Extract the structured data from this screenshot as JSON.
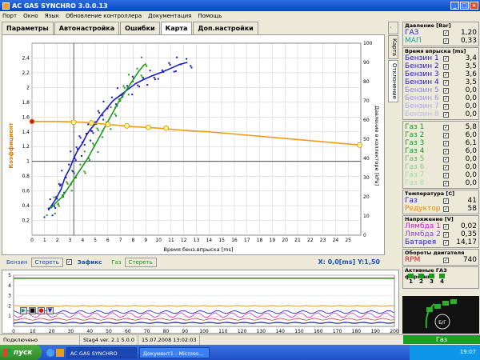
{
  "window": {
    "title": "AC GAS SYNCHRO  3.0.0.13",
    "buttons": [
      "_",
      "□",
      "×"
    ]
  },
  "menu": [
    "Порт",
    "Окно",
    "Язык",
    "Обновление контроллера",
    "Документация",
    "Помощь"
  ],
  "tabs": [
    {
      "label": "Параметры"
    },
    {
      "label": "Автонастройка"
    },
    {
      "label": "Ошибки"
    },
    {
      "label": "Карта"
    },
    {
      "label": "Доп.настройки"
    }
  ],
  "vtabs": [
    "Карта",
    "Отклонение"
  ],
  "chart": {
    "ylabel_left": "Коэффициент",
    "ylabel_right": "Давление в коллекторе [kPa]",
    "xlabel": "Время бенз.впрыска [ms]"
  },
  "chart_data": {
    "type": "scatter",
    "x_ticks": [
      "0",
      "1",
      "2",
      "3",
      "4",
      "5",
      "6",
      "7",
      "8",
      "9",
      "10",
      "11",
      "12",
      "13",
      "14",
      "15",
      "16",
      "17",
      "18",
      "19",
      "20",
      "21",
      "22",
      "23",
      "24",
      "25"
    ],
    "y_left_ticks": [
      "0,2",
      "0,4",
      "0,6",
      "0,8",
      "1",
      "1,2",
      "1,4",
      "1,6",
      "1,8",
      "2",
      "2,2",
      "2,4"
    ],
    "y_right_ticks": [
      "0",
      "10",
      "20",
      "30",
      "40",
      "50",
      "60",
      "70",
      "80",
      "90",
      "100"
    ],
    "xlim": [
      0,
      26
    ],
    "ylim_left": [
      0,
      2.6
    ],
    "ylim_right": [
      0,
      100
    ],
    "series": [
      {
        "color": "#1a1acc",
        "axis": "right",
        "points": [
          [
            1.3,
            13
          ],
          [
            1.6,
            16
          ],
          [
            1.9,
            19
          ],
          [
            2.3,
            24
          ],
          [
            2.6,
            30
          ],
          [
            3,
            35
          ],
          [
            3.3,
            40
          ],
          [
            3.6,
            44
          ],
          [
            4,
            48
          ],
          [
            4.3,
            52
          ],
          [
            4.6,
            55
          ],
          [
            5,
            58
          ],
          [
            5.4,
            62
          ],
          [
            5.9,
            66
          ],
          [
            6.4,
            70
          ],
          [
            7,
            73
          ],
          [
            7.6,
            76
          ],
          [
            8.2,
            79
          ],
          [
            8.8,
            81
          ],
          [
            9.5,
            83
          ],
          [
            10.3,
            85
          ],
          [
            11,
            87
          ],
          [
            11.7,
            89
          ],
          [
            12.3,
            90
          ]
        ]
      },
      {
        "color": "#1a9a1a",
        "axis": "right",
        "points": [
          [
            1.5,
            14
          ],
          [
            1.9,
            17
          ],
          [
            2.4,
            20
          ],
          [
            2.9,
            25
          ],
          [
            3.4,
            30
          ],
          [
            3.9,
            35
          ],
          [
            4.4,
            40
          ],
          [
            4.9,
            46
          ],
          [
            5.4,
            52
          ],
          [
            5.9,
            58
          ],
          [
            6.4,
            64
          ],
          [
            6.9,
            70
          ],
          [
            7.4,
            75
          ],
          [
            7.9,
            80
          ],
          [
            8.4,
            85
          ],
          [
            8.9,
            89
          ]
        ]
      },
      {
        "color": "#f29a1a",
        "axis": "left",
        "points": [
          [
            0,
            1.54
          ],
          [
            2,
            1.54
          ],
          [
            4,
            1.53
          ],
          [
            6,
            1.5
          ],
          [
            8,
            1.47
          ],
          [
            10,
            1.45
          ],
          [
            12,
            1.42
          ],
          [
            14,
            1.4
          ],
          [
            16,
            1.37
          ],
          [
            18,
            1.34
          ],
          [
            20,
            1.31
          ],
          [
            22,
            1.28
          ],
          [
            24,
            1.25
          ],
          [
            26,
            1.22
          ]
        ]
      }
    ],
    "orange_markers": [
      [
        0,
        1.54
      ],
      [
        3.3,
        1.53
      ],
      [
        4.7,
        1.52
      ],
      [
        6,
        1.5
      ],
      [
        7.5,
        1.48
      ],
      [
        9.2,
        1.46
      ],
      [
        10.6,
        1.45
      ],
      [
        25.9,
        1.22
      ]
    ],
    "crosshair": {
      "x": 3.3,
      "y": 1.0
    }
  },
  "bottom": {
    "benzin_label": "Бензин",
    "clear1": "Стереть",
    "zafiks": "Зафикс",
    "gas_label": "Газ",
    "clear2": "Стереть",
    "coord_x": "X: 0,0[ms] Y:1,50"
  },
  "mini_chart": {
    "y_ticks": [
      "1",
      "2",
      "3",
      "4",
      "5"
    ],
    "x_ticks": [
      "0",
      "10",
      "20",
      "30",
      "40",
      "50",
      "60",
      "70",
      "80",
      "90",
      "100",
      "110",
      "120",
      "130",
      "140",
      "150",
      "160",
      "170",
      "180",
      "190",
      "200"
    ]
  },
  "panel": {
    "pressure": {
      "title": "Давление [Bar]",
      "rows": [
        {
          "label": "ГАЗ",
          "value": "1,20",
          "color": "#1a1acc"
        },
        {
          "label": "МАП",
          "value": "0,33",
          "color": "#1aa0a0"
        }
      ]
    },
    "inj_time": {
      "title": "Время впрыска [ms]",
      "rows": [
        {
          "label": "Бензин 1",
          "value": "3,4",
          "color": "#1a1acc"
        },
        {
          "label": "Бензин 2",
          "value": "3,5",
          "color": "#1a1acc"
        },
        {
          "label": "Бензин 3",
          "value": "3,6",
          "color": "#1a1acc"
        },
        {
          "label": "Бензин 4",
          "value": "3,5",
          "color": "#1a1acc"
        },
        {
          "label": "Бензин 5",
          "value": "0,0",
          "color": "#8888dd"
        },
        {
          "label": "Бензин 6",
          "value": "0,0",
          "color": "#9999dd"
        },
        {
          "label": "Бензин 7",
          "value": "0,0",
          "color": "#aaaaee"
        },
        {
          "label": "Бензин 8",
          "value": "0,0",
          "color": "#bbbbee"
        }
      ]
    },
    "gas": {
      "rows": [
        {
          "label": "Газ 1",
          "value": "5,8",
          "color": "#1a9a1a"
        },
        {
          "label": "Газ 2",
          "value": "6,0",
          "color": "#1a9a1a"
        },
        {
          "label": "Газ 3",
          "value": "6,1",
          "color": "#1a9a1a"
        },
        {
          "label": "Газ 4",
          "value": "6,0",
          "color": "#1a9a1a"
        },
        {
          "label": "Газ 5",
          "value": "0,0",
          "color": "#66bb66"
        },
        {
          "label": "Газ 6",
          "value": "0,0",
          "color": "#88cc88"
        },
        {
          "label": "Газ 7",
          "value": "0,0",
          "color": "#99dd99"
        },
        {
          "label": "Газ 8",
          "value": "0,0",
          "color": "#aaddaa"
        }
      ]
    },
    "temperature": {
      "title": "Температура [C]",
      "rows": [
        {
          "label": "Газ",
          "value": "41",
          "color": "#1a1acc"
        },
        {
          "label": "Редуктор",
          "value": "58",
          "color": "#e08a10"
        }
      ]
    },
    "voltage": {
      "title": "Напряжение [V]",
      "rows": [
        {
          "label": "Лямбда 1",
          "value": "0,02",
          "color": "#cc1acc"
        },
        {
          "label": "Лямбда 2",
          "value": "0,35",
          "color": "#8a4acc"
        },
        {
          "label": "Батарея",
          "value": "14,17",
          "color": "#1a1acc"
        }
      ]
    },
    "rpm": {
      "title": "Обороты двигателя",
      "rows": [
        {
          "label": "RPM",
          "value": "740",
          "color": "#cc1a1a"
        }
      ]
    },
    "injectors": {
      "title": "Активные ГАЗ форсунки",
      "labels": [
        "1",
        "2",
        "3",
        "4"
      ]
    }
  },
  "status": {
    "connected": "Подключено",
    "ver": "Stag4  ver. 2.1  5.0.0",
    "date": "15.07.2008 13:02:03",
    "gas": "Газ"
  },
  "taskbar": {
    "start": "пуск",
    "items": [
      "AC GAS SYNCHRO",
      "Документ1 - Microso..."
    ],
    "clock": "19:07"
  }
}
